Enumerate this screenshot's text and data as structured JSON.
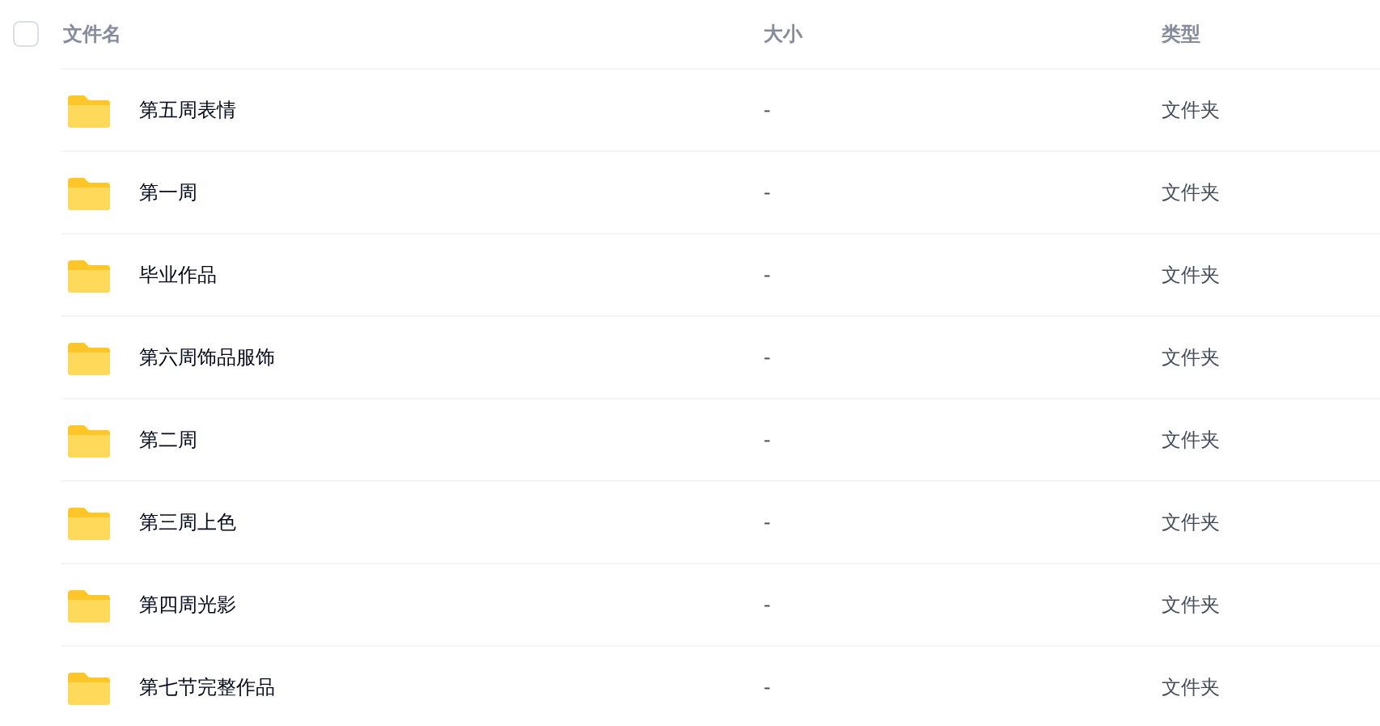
{
  "table": {
    "select_all": {
      "checked": false
    },
    "columns": [
      "文件名",
      "大小",
      "类型"
    ],
    "rows": [
      {
        "name": "第五周表情",
        "size": "-",
        "type": "文件夹"
      },
      {
        "name": "第一周",
        "size": "-",
        "type": "文件夹"
      },
      {
        "name": "毕业作品",
        "size": "-",
        "type": "文件夹"
      },
      {
        "name": "第六周饰品服饰",
        "size": "-",
        "type": "文件夹"
      },
      {
        "name": "第二周",
        "size": "-",
        "type": "文件夹"
      },
      {
        "name": "第三周上色",
        "size": "-",
        "type": "文件夹"
      },
      {
        "name": "第四周光影",
        "size": "-",
        "type": "文件夹"
      },
      {
        "name": "第七节完整作品",
        "size": "-",
        "type": "文件夹"
      }
    ]
  }
}
